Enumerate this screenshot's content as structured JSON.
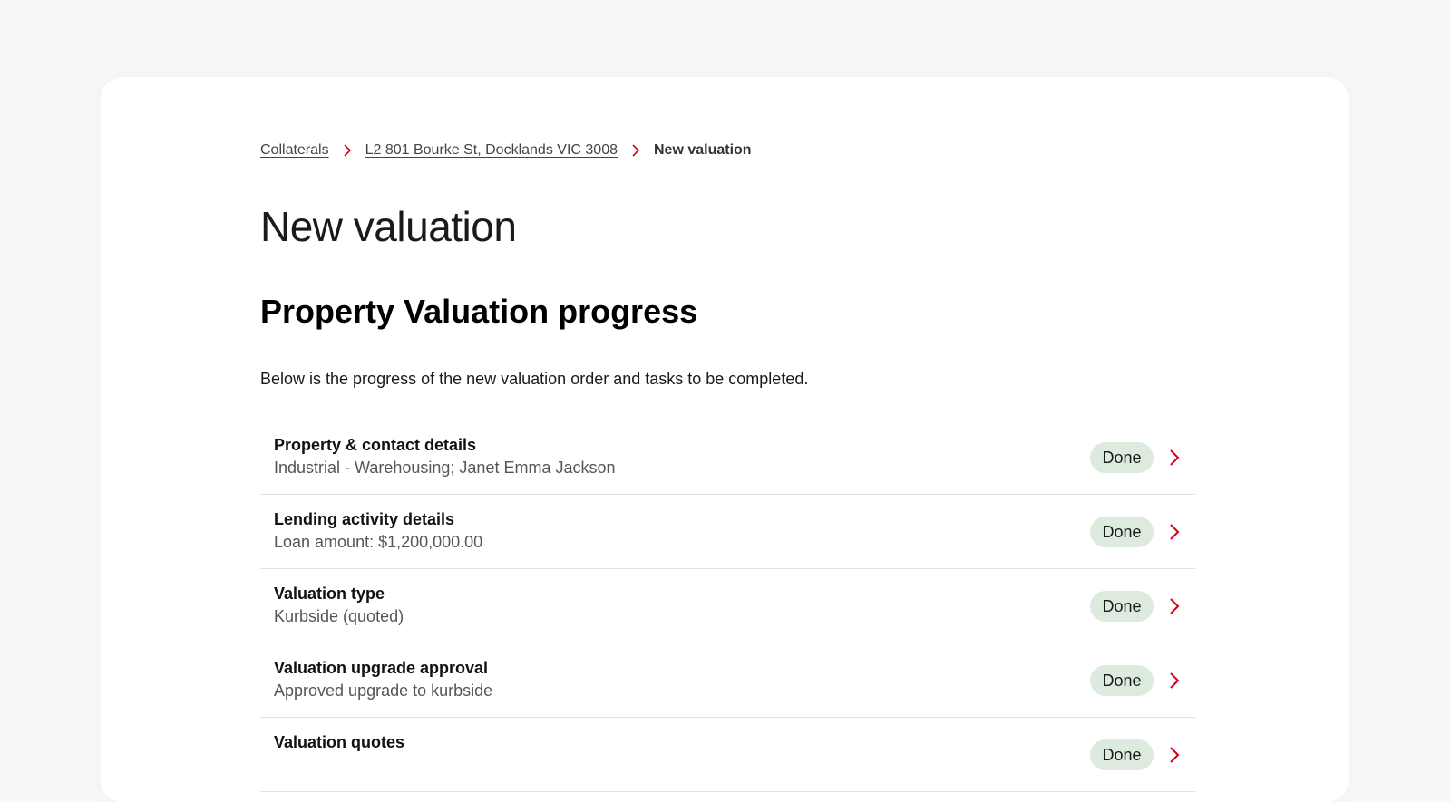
{
  "breadcrumb": {
    "items": [
      {
        "label": "Collaterals"
      },
      {
        "label": "L2 801 Bourke St, Docklands VIC 3008"
      }
    ],
    "current": "New valuation"
  },
  "page_title": "New valuation",
  "section_title": "Property Valuation progress",
  "intro": "Below is the progress of the new valuation order and tasks to be completed.",
  "tasks": [
    {
      "title": "Property & contact details",
      "subtitle": "Industrial - Warehousing; Janet Emma Jackson",
      "status": "Done"
    },
    {
      "title": "Lending activity details",
      "subtitle": "Loan amount: $1,200,000.00",
      "status": "Done"
    },
    {
      "title": "Valuation type",
      "subtitle": "Kurbside (quoted)",
      "status": "Done"
    },
    {
      "title": "Valuation upgrade approval",
      "subtitle": "Approved upgrade to kurbside",
      "status": "Done"
    },
    {
      "title": "Valuation quotes",
      "subtitle": "",
      "status": "Done"
    }
  ],
  "colors": {
    "accent": "#d0021b",
    "done_badge_bg": "#dcebdd"
  },
  "icons": {
    "separator": "chevron-right-icon",
    "row_action": "chevron-right-icon"
  }
}
